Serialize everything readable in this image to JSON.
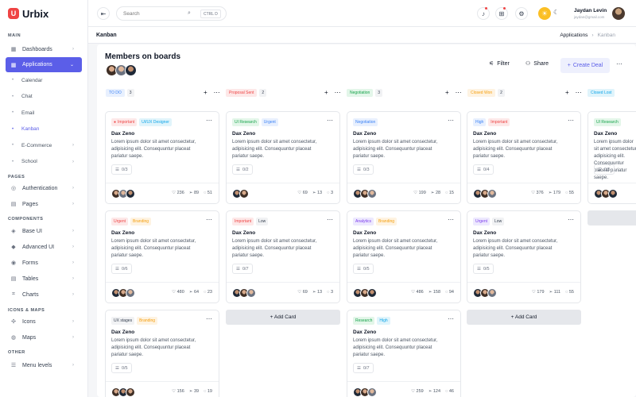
{
  "app": {
    "logo_letter": "U",
    "name": "Urbix"
  },
  "sidebar": {
    "sections": {
      "main": "MAIN",
      "pages": "PAGES",
      "components": "COMPONENTS",
      "icons_maps": "ICONS & MAPS",
      "other": "OTHER"
    },
    "dashboards": "Dashboards",
    "applications": "Applications",
    "sub": [
      "Calendar",
      "Chat",
      "Email",
      "Kanban",
      "E-Commerce",
      "School"
    ],
    "authentication": "Authentication",
    "pages": "Pages",
    "base_ui": "Base UI",
    "advanced_ui": "Advanced UI",
    "forms": "Forms",
    "tables": "Tables",
    "charts": "Charts",
    "icons": "Icons",
    "maps": "Maps",
    "menu_levels": "Menu levels"
  },
  "header": {
    "search_placeholder": "Search",
    "kbd": "CTRL D",
    "user_name": "Jaydan Levin",
    "user_email": "jaydan@gmail.com"
  },
  "breadcrumb": {
    "title": "Kanban",
    "parent": "Applications",
    "current": "Kanban"
  },
  "board": {
    "title": "Members on boards",
    "filter": "Filter",
    "share": "Share",
    "create_deal": "Create Deal",
    "add_card": "+ Add Card"
  },
  "columns": [
    {
      "name": "TO DO",
      "count": "3",
      "color": "#3b82f6",
      "bg": "#e8f0fe"
    },
    {
      "name": "Proposal Sent",
      "count": "2",
      "color": "#ef4444",
      "bg": "#fde8e8"
    },
    {
      "name": "Negotiation",
      "count": "3",
      "color": "#16a34a",
      "bg": "#e3f6e9"
    },
    {
      "name": "Closed Won",
      "count": "2",
      "color": "#f59e0b",
      "bg": "#fef3e2"
    },
    {
      "name": "Closed Lost",
      "color": "#0ea5e9",
      "bg": "#e0f4fb"
    }
  ],
  "card_common": {
    "title": "Dax Zeno",
    "desc": "Lorem ipsum dolor sit amet consectetur, adipisicing elit. Consequuntur placeat pariatur saepe."
  },
  "cards": {
    "c1": {
      "tags": [
        "Important",
        "UI/UX Designer"
      ],
      "checklist": "0/3",
      "likes": "236",
      "shares": "89",
      "comments": "51"
    },
    "c2": {
      "tags": [
        "Urgent",
        "Branding"
      ],
      "checklist": "0/6",
      "likes": "480",
      "shares": "64",
      "comments": "23"
    },
    "c3": {
      "tags": [
        "UX stages",
        "Branding"
      ],
      "checklist": "0/5",
      "likes": "156",
      "shares": "39",
      "comments": "19"
    },
    "c4": {
      "tags": [
        "UI Research",
        "Urgent"
      ],
      "checklist": "0/2",
      "likes": "69",
      "shares": "13",
      "comments": "3"
    },
    "c5": {
      "tags": [
        "Important",
        "Low"
      ],
      "checklist": "0/7",
      "likes": "69",
      "shares": "13",
      "comments": "3"
    },
    "c6": {
      "tags": [
        "Negotiation"
      ],
      "checklist": "0/3",
      "likes": "199",
      "shares": "28",
      "comments": "15"
    },
    "c7": {
      "tags": [
        "Analytics",
        "Branding"
      ],
      "checklist": "0/5",
      "likes": "486",
      "shares": "158",
      "comments": "94"
    },
    "c8": {
      "tags": [
        "Research",
        "High"
      ],
      "checklist": "0/7",
      "likes": "259",
      "shares": "124",
      "comments": "46"
    },
    "c9": {
      "tags": [
        "High",
        "Important"
      ],
      "checklist": "0/4",
      "likes": "376",
      "shares": "179",
      "comments": "55"
    },
    "c10": {
      "tags": [
        "Urgent",
        "Low"
      ],
      "checklist": "0/5",
      "likes": "179",
      "shares": "111",
      "comments": "55"
    },
    "c11": {
      "tags": [
        "UI Research"
      ],
      "checklist": "0/5"
    }
  }
}
